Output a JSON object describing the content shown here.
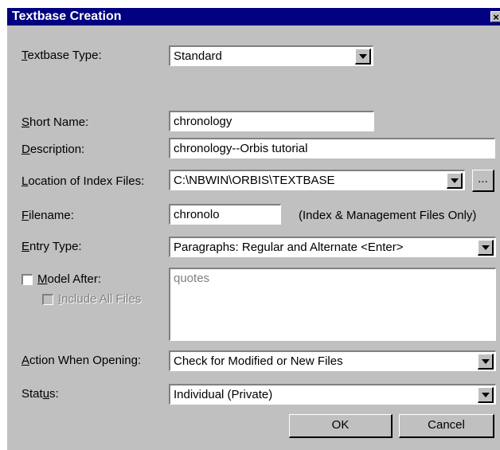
{
  "window": {
    "title": "Textbase Creation",
    "close_glyph": "×"
  },
  "textbase_type": {
    "label_ul": "T",
    "label_rest": "extbase Type:",
    "value": "Standard"
  },
  "short_name": {
    "label_ul": "S",
    "label_rest": "hort Name:",
    "value": "chronology"
  },
  "description": {
    "label_ul": "D",
    "label_rest": "escription:",
    "value": "chronology--Orbis tutorial"
  },
  "location": {
    "label_ul": "L",
    "label_rest": "ocation of Index Files:",
    "value": "C:\\NBWIN\\ORBIS\\TEXTBASE",
    "browse_label": "..."
  },
  "filename": {
    "label_ul": "F",
    "label_rest": "ilename:",
    "value": "chronolo",
    "note": "(Index & Management Files Only)"
  },
  "entry_type": {
    "label_ul": "E",
    "label_rest": "ntry Type:",
    "value": "Paragraphs: Regular and Alternate <Enter>"
  },
  "model_after": {
    "label_ul": "M",
    "label_rest": "odel After:",
    "checked": false,
    "placeholder": "quotes"
  },
  "include_all": {
    "label_ul": "I",
    "label_rest": "nclude All Files",
    "checked": false
  },
  "action_when_opening": {
    "label_ul": "A",
    "label_rest": "ction When Opening:",
    "value": "Check for Modified or New Files"
  },
  "status": {
    "label_pre": "Stat",
    "label_ul": "u",
    "label_rest": "s:",
    "value": "Individual (Private)"
  },
  "buttons": {
    "ok": "OK",
    "cancel": "Cancel"
  },
  "icons": {
    "dropdown": "chevron-down-icon",
    "close": "close-icon"
  }
}
